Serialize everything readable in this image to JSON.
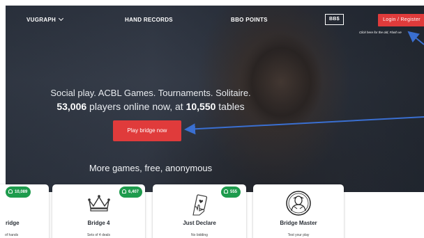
{
  "nav": {
    "vugraph": "VUGRAPH",
    "hand_records": "HAND RECORDS",
    "bbo_points": "BBO POINTS",
    "bbs": "BB$",
    "login": "Login / Register",
    "flash_note": "Click here for the old, Flash ve"
  },
  "hero": {
    "headline": "Social play. ACBL Games. Tournaments. Solitaire.",
    "players_online": "53,006",
    "players_text": "players online now, at",
    "tables": "10,550",
    "tables_text": "tables",
    "play_button": "Play bridge now",
    "more_games": "More games, free, anonymous"
  },
  "cards": [
    {
      "title": "ridge",
      "subtitle": "of hands",
      "count": "10,089",
      "icon": "cards-icon"
    },
    {
      "title": "Bridge 4",
      "subtitle": "Sets of 4 deals",
      "count": "6,407",
      "icon": "crown-icon"
    },
    {
      "title": "Just Declare",
      "subtitle": "No bidding",
      "count": "555",
      "icon": "hand-card-icon"
    },
    {
      "title": "Bridge Master",
      "subtitle": "Test your play",
      "count": "",
      "icon": "master-portrait-icon"
    }
  ],
  "colors": {
    "accent_red": "#e03b3b",
    "badge_green": "#1e9b4d",
    "arrow_blue": "#3a6fd1"
  }
}
